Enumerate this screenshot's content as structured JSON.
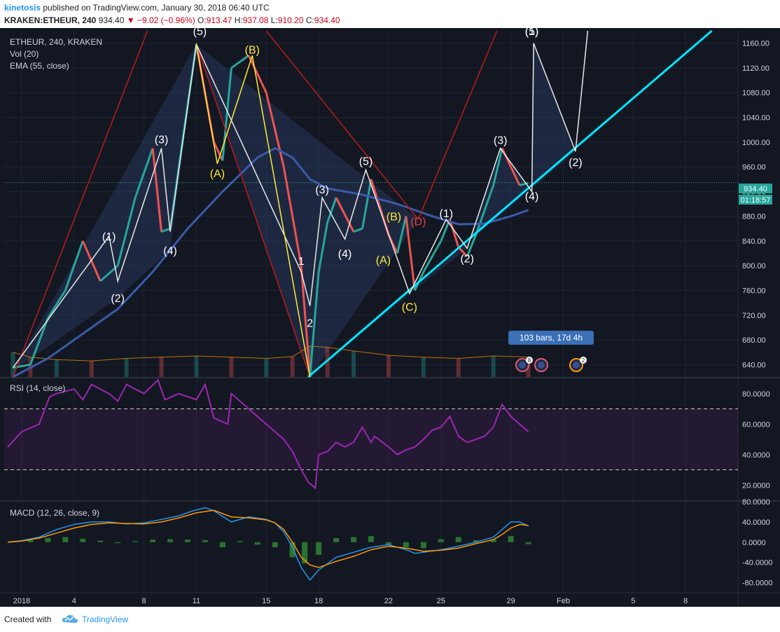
{
  "header": {
    "author": "kinetosis",
    "published_text": "published on TradingView.com, January 30, 2018 06:40 UTC",
    "symbol": "KRAKEN:ETHEUR, 240",
    "last": "934.40",
    "change": "▼ −9.02 (−0.96%)",
    "o_label": "O:",
    "o": "913.47",
    "h_label": "H:",
    "h": "937.08",
    "l_label": "L:",
    "l": "910.20",
    "c_label": "C:",
    "c": "934.40"
  },
  "legend": {
    "main": "ETHEUR, 240, KRAKEN",
    "vol": "Vol (20)",
    "ema": "EMA (55, close)",
    "rsi": "RSI (14, close)",
    "macd": "MACD (12, 26, close, 9)"
  },
  "price_badges": {
    "last": "934.40",
    "timer": "01:18:57"
  },
  "measure_label": "103 bars, 17d 4h",
  "event_badges": [
    "8",
    "2"
  ],
  "footer": {
    "created": "Created with",
    "brand": "TradingView"
  },
  "colors": {
    "background": "#131722",
    "up": "#26a69a",
    "down": "#ef5350",
    "ema": "#3a5ba9",
    "trendline": "#00e5ff",
    "rsi": "#9c27b0",
    "macd": "#2196f3",
    "signal": "#ff9800",
    "wave_fill": "#2a3f66",
    "yellow": "#ffeb3b",
    "red_lines": "#b71c1c"
  },
  "chart_data": [
    {
      "type": "candlestick",
      "title": "ETHEUR, 240, KRAKEN",
      "y_ticks": [
        "1160.00",
        "1120.00",
        "1080.00",
        "1040.00",
        "1000.00",
        "960.00",
        "920.00",
        "880.00",
        "840.00",
        "800.00",
        "760.00",
        "720.00",
        "680.00",
        "640.00"
      ],
      "ylim": [
        620,
        1180
      ],
      "x_ticks": [
        "2018",
        "4",
        "8",
        "11",
        "15",
        "18",
        "22",
        "25",
        "29",
        "Feb",
        "5",
        "8"
      ],
      "x_tick_values": [
        1,
        4,
        8,
        11,
        15,
        18,
        22,
        25,
        29,
        32,
        36,
        39
      ],
      "xlim": [
        0,
        42
      ],
      "last_price": 934.4,
      "price_path": [
        [
          0.5,
          635
        ],
        [
          1.5,
          640
        ],
        [
          2.5,
          715
        ],
        [
          3.5,
          760
        ],
        [
          4.5,
          840
        ],
        [
          5.5,
          775
        ],
        [
          6.5,
          800
        ],
        [
          7.5,
          910
        ],
        [
          8.5,
          990
        ],
        [
          9.0,
          855
        ],
        [
          9.5,
          860
        ],
        [
          10.5,
          1060
        ],
        [
          11.0,
          1158
        ],
        [
          12.0,
          1000
        ],
        [
          12.5,
          970
        ],
        [
          13.0,
          1120
        ],
        [
          14.0,
          1140
        ],
        [
          15.0,
          1080
        ],
        [
          16.0,
          960
        ],
        [
          17.0,
          800
        ],
        [
          17.5,
          620
        ],
        [
          18.0,
          790
        ],
        [
          18.5,
          870
        ],
        [
          19.0,
          910
        ],
        [
          20.0,
          855
        ],
        [
          20.5,
          860
        ],
        [
          21.0,
          940
        ],
        [
          22.0,
          850
        ],
        [
          22.5,
          820
        ],
        [
          23.0,
          880
        ],
        [
          23.5,
          760
        ],
        [
          24.0,
          790
        ],
        [
          25.0,
          840
        ],
        [
          25.5,
          875
        ],
        [
          26.0,
          830
        ],
        [
          26.5,
          815
        ],
        [
          27.0,
          850
        ],
        [
          28.0,
          930
        ],
        [
          28.5,
          990
        ],
        [
          29.0,
          960
        ],
        [
          29.5,
          930
        ],
        [
          30.0,
          934
        ]
      ],
      "ema_path": [
        [
          0.5,
          620
        ],
        [
          2.5,
          650
        ],
        [
          4.5,
          690
        ],
        [
          6.5,
          730
        ],
        [
          8.5,
          790
        ],
        [
          10.5,
          860
        ],
        [
          12.5,
          920
        ],
        [
          14.5,
          975
        ],
        [
          15.5,
          990
        ],
        [
          16.5,
          975
        ],
        [
          17.5,
          940
        ],
        [
          18.5,
          925
        ],
        [
          20.5,
          915
        ],
        [
          22.5,
          900
        ],
        [
          24.5,
          880
        ],
        [
          26.0,
          867
        ],
        [
          27.5,
          868
        ],
        [
          29.0,
          880
        ],
        [
          30.0,
          890
        ]
      ],
      "volume_path": [
        [
          0.5,
          660
        ],
        [
          1.5,
          652
        ],
        [
          3,
          648
        ],
        [
          5,
          646
        ],
        [
          7,
          650
        ],
        [
          9,
          652
        ],
        [
          11,
          654
        ],
        [
          13,
          652
        ],
        [
          15,
          650
        ],
        [
          16.5,
          653
        ],
        [
          17.5,
          670
        ],
        [
          18.5,
          668
        ],
        [
          20,
          662
        ],
        [
          22,
          655
        ],
        [
          24,
          652
        ],
        [
          26,
          650
        ],
        [
          28,
          654
        ],
        [
          30,
          652
        ]
      ],
      "wave_labels": [
        {
          "text": "(1)",
          "x": 6.0,
          "y": 848,
          "color": "white"
        },
        {
          "text": "(2)",
          "x": 6.5,
          "y": 748,
          "color": "white"
        },
        {
          "text": "(3)",
          "x": 9.0,
          "y": 1005,
          "color": "white"
        },
        {
          "text": "(4)",
          "x": 9.5,
          "y": 825,
          "color": "white"
        },
        {
          "text": "(5)",
          "x": 11.2,
          "y": 1180,
          "color": "white"
        },
        {
          "text": "(A)",
          "x": 12.2,
          "y": 950,
          "color": "yellow"
        },
        {
          "text": "(B)",
          "x": 14.2,
          "y": 1150,
          "color": "yellow"
        },
        {
          "text": "1",
          "x": 17.0,
          "y": 808,
          "color": "white"
        },
        {
          "text": "2",
          "x": 17.5,
          "y": 708,
          "color": "white"
        },
        {
          "text": "(3)",
          "x": 18.2,
          "y": 924,
          "color": "white"
        },
        {
          "text": "(4)",
          "x": 19.5,
          "y": 820,
          "color": "white"
        },
        {
          "text": "(5)",
          "x": 20.7,
          "y": 970,
          "color": "white"
        },
        {
          "text": "(B)",
          "x": 22.3,
          "y": 880,
          "color": "yellow"
        },
        {
          "text": "(A)",
          "x": 21.7,
          "y": 810,
          "color": "yellow"
        },
        {
          "text": "(C)",
          "x": 23.2,
          "y": 734,
          "color": "yellow"
        },
        {
          "text": "(D)",
          "x": 23.7,
          "y": 872,
          "color": "red"
        },
        {
          "text": "(1)",
          "x": 25.3,
          "y": 885,
          "color": "white"
        },
        {
          "text": "(2)",
          "x": 26.5,
          "y": 812,
          "color": "white"
        },
        {
          "text": "(3)",
          "x": 28.4,
          "y": 1004,
          "color": "white"
        },
        {
          "text": "(4)",
          "x": 30.2,
          "y": 913,
          "color": "white"
        },
        {
          "text": "(1)",
          "x": 30.2,
          "y": 1180,
          "color": "white"
        },
        {
          "text": "(5)",
          "x": 30.2,
          "y": 1180,
          "color": "white"
        },
        {
          "text": "(2)",
          "x": 32.7,
          "y": 968,
          "color": "white"
        }
      ]
    },
    {
      "type": "line",
      "title": "RSI (14, close)",
      "y_ticks": [
        "80.0000",
        "60.0000",
        "40.0000",
        "20.0000"
      ],
      "ylim": [
        10,
        90
      ],
      "bands": [
        70,
        30
      ],
      "xlim": [
        0,
        42
      ],
      "series": [
        {
          "x": [
            0.2,
            1,
            2,
            2.6,
            3,
            4,
            4.5,
            5,
            6,
            6.5,
            7,
            8,
            8.8,
            9.2,
            10,
            11,
            11.5,
            12,
            12.8,
            13,
            14,
            15,
            16,
            16.5,
            17,
            17.4,
            17.8,
            18,
            18.5,
            19,
            19.5,
            20,
            20.5,
            21,
            21.2,
            22,
            22.5,
            23,
            23.5,
            24,
            24.5,
            25,
            25.5,
            26,
            26.5,
            27,
            27.5,
            28,
            28.5,
            29,
            29.5,
            30
          ],
          "y": [
            45,
            55,
            60,
            78,
            80,
            83,
            76,
            86,
            80,
            75,
            86,
            80,
            89,
            76,
            80,
            76,
            86,
            64,
            60,
            80,
            70,
            60,
            50,
            42,
            30,
            22,
            18,
            40,
            42,
            48,
            45,
            48,
            58,
            48,
            52,
            45,
            40,
            43,
            45,
            50,
            56,
            58,
            65,
            52,
            48,
            50,
            52,
            58,
            73,
            65,
            60,
            55
          ]
        }
      ]
    },
    {
      "type": "line",
      "title": "MACD (12, 26, close, 9)",
      "y_ticks": [
        "80.0000",
        "40.0000",
        "0.0000",
        "-40.0000",
        "-80.0000"
      ],
      "ylim": [
        -100,
        80
      ],
      "xlim": [
        0,
        42
      ],
      "series": [
        {
          "x": [
            0.2,
            1,
            2,
            3,
            4,
            5,
            6,
            7,
            8,
            9,
            10,
            10.8,
            11.5,
            12,
            13,
            14,
            15,
            15.5,
            16,
            16.5,
            17,
            17.5,
            18,
            19,
            20,
            21,
            22,
            23,
            23.5,
            24,
            25,
            26,
            27,
            28,
            28.5,
            29,
            29.5,
            30
          ],
          "y": [
            0,
            3,
            10,
            25,
            35,
            40,
            40,
            36,
            38,
            45,
            52,
            62,
            68,
            62,
            40,
            50,
            45,
            38,
            20,
            -10,
            -50,
            -75,
            -55,
            -30,
            -20,
            -10,
            -5,
            -15,
            -22,
            -20,
            -15,
            -8,
            0,
            10,
            25,
            40,
            40,
            32
          ]
        },
        {
          "x": [
            0.2,
            1,
            2,
            3,
            4,
            5,
            6,
            7,
            8,
            9,
            10,
            11,
            12,
            13,
            14,
            15,
            15.5,
            16,
            16.5,
            17,
            17.5,
            18,
            19,
            20,
            21,
            22,
            23,
            24,
            25,
            26,
            27,
            28,
            28.5,
            29,
            29.5,
            30
          ],
          "y": [
            0,
            2,
            8,
            18,
            28,
            35,
            38,
            37,
            36,
            40,
            48,
            58,
            63,
            50,
            48,
            44,
            38,
            25,
            0,
            -30,
            -45,
            -50,
            -38,
            -28,
            -15,
            -8,
            -12,
            -18,
            -16,
            -12,
            -3,
            5,
            15,
            28,
            35,
            33
          ]
        }
      ],
      "histogram": [
        [
          0.5,
          2
        ],
        [
          1.5,
          4
        ],
        [
          2.5,
          8
        ],
        [
          3.5,
          10
        ],
        [
          4.5,
          7
        ],
        [
          5.5,
          3
        ],
        [
          6.5,
          -2
        ],
        [
          7.5,
          2
        ],
        [
          8.5,
          5
        ],
        [
          9.5,
          6
        ],
        [
          10.5,
          5
        ],
        [
          11.5,
          4
        ],
        [
          12.5,
          -10
        ],
        [
          13.5,
          2
        ],
        [
          14.5,
          -5
        ],
        [
          15.5,
          -10
        ],
        [
          16.5,
          -30
        ],
        [
          17.2,
          -42
        ],
        [
          18,
          -25
        ],
        [
          19,
          8
        ],
        [
          20,
          10
        ],
        [
          21,
          12
        ],
        [
          22,
          -6
        ],
        [
          23,
          -10
        ],
        [
          24,
          -12
        ],
        [
          25,
          6
        ],
        [
          26,
          10
        ],
        [
          27,
          4
        ],
        [
          28,
          6
        ],
        [
          29,
          12
        ],
        [
          30,
          -4
        ]
      ]
    }
  ]
}
